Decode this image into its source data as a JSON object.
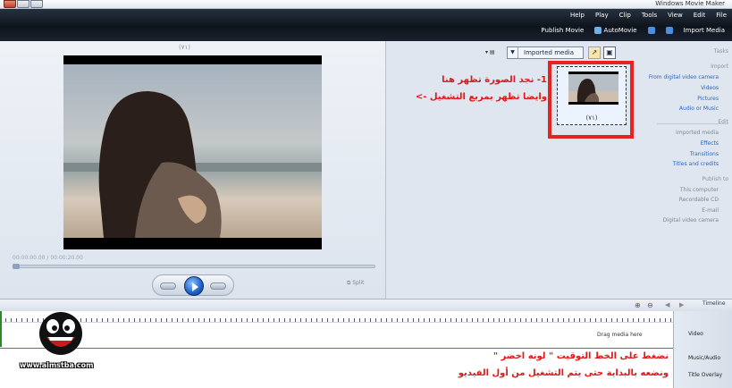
{
  "window": {
    "title": "Windows Movie Maker"
  },
  "menu": [
    "File",
    "Edit",
    "View",
    "Tools",
    "Clip",
    "Play",
    "Help"
  ],
  "toolbar": {
    "import_media": "Import Media",
    "auto_movie": "AutoMovie",
    "publish_movie": "Publish Movie"
  },
  "preview": {
    "title": "(٧١)",
    "timecode": "00:00:00.00 / 00:00:20.00",
    "split_label": "Split"
  },
  "collection": {
    "dropdown_value": "Imported media",
    "clip_label": "(٧١)"
  },
  "annotations": {
    "top_line1": "1- نجد الصورة تظهر هنا",
    "top_line2": "وايضا تظهر بمربع التشغيل ->",
    "bottom_line1": "نضغط على الخط التوقيت \" لونه اخضر \"",
    "bottom_line2": "ونضعه بالبداية حتى يتم التشغيل من أول الفيديو"
  },
  "tasks": {
    "header": "Tasks",
    "import_header": "Import",
    "import_items": [
      "From digital video camera",
      "Videos",
      "Pictures",
      "Audio or Music"
    ],
    "edit_header": "Edit",
    "edit_items": [
      "Imported media",
      "Effects",
      "Transitions",
      "Titles and credits"
    ],
    "publish_header": "Publish to",
    "publish_items": [
      "This computer",
      "Recordable CD",
      "E-mail",
      "Digital video camera"
    ]
  },
  "timeline": {
    "view_label": "Timeline",
    "drag_hint": "Drag media here",
    "tracks": [
      "Video",
      "Music/Audio",
      "Title Overlay"
    ]
  },
  "watermark": "www.almstba.com",
  "colors": {
    "annotation": "#e01818",
    "highlight_frame": "#e52320",
    "playhead": "#2a8a2a",
    "link": "#2667c9"
  }
}
